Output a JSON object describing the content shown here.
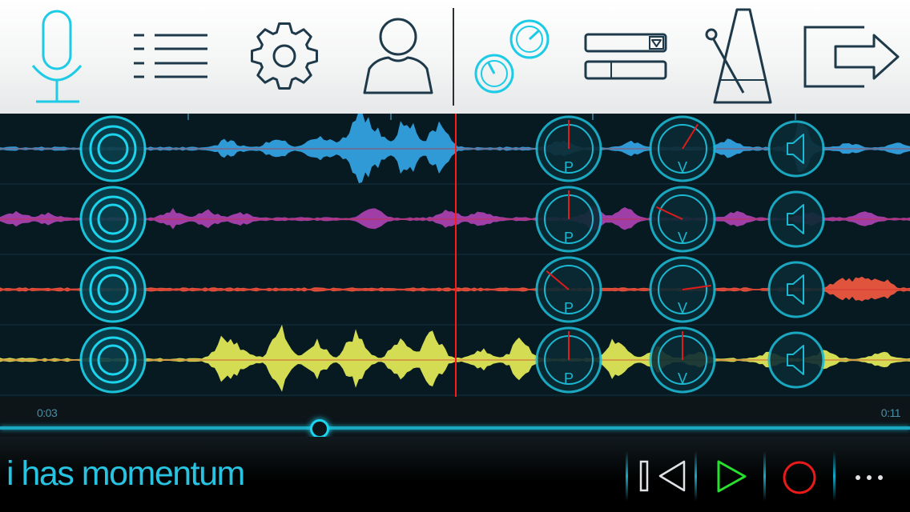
{
  "toolbar": {
    "buttons": [
      {
        "name": "microphone",
        "active": true
      },
      {
        "name": "track-list"
      },
      {
        "name": "settings"
      },
      {
        "name": "profile"
      },
      {
        "name": "effects-knobs",
        "active": true
      },
      {
        "name": "input-selector"
      },
      {
        "name": "metronome"
      },
      {
        "name": "export"
      }
    ]
  },
  "tracks": [
    {
      "color": "#2f9ad6",
      "pan_label": "P",
      "vol_label": "V",
      "pan_angle": 0,
      "vol_angle": 32,
      "muted": false
    },
    {
      "color": "#a03ea8",
      "pan_label": "P",
      "vol_label": "V",
      "pan_angle": 0,
      "vol_angle": -65,
      "muted": false
    },
    {
      "color": "#e0533d",
      "pan_label": "P",
      "vol_label": "V",
      "pan_angle": -50,
      "vol_angle": 82,
      "muted": false
    },
    {
      "color": "#d3dc52",
      "pan_label": "P",
      "vol_label": "V",
      "pan_angle": 0,
      "vol_angle": 0,
      "muted": false
    }
  ],
  "playhead_fraction": 0.065,
  "timeline": {
    "start": "0:03",
    "end": "0:11",
    "position_fraction": 0.35
  },
  "song": {
    "title": "i has momentum"
  },
  "transport": {
    "buttons": [
      "rewind",
      "play",
      "record",
      "more"
    ],
    "play_color": "#27e02d",
    "record_color": "#e81a1a",
    "accent_color": "#1bd4ee"
  }
}
